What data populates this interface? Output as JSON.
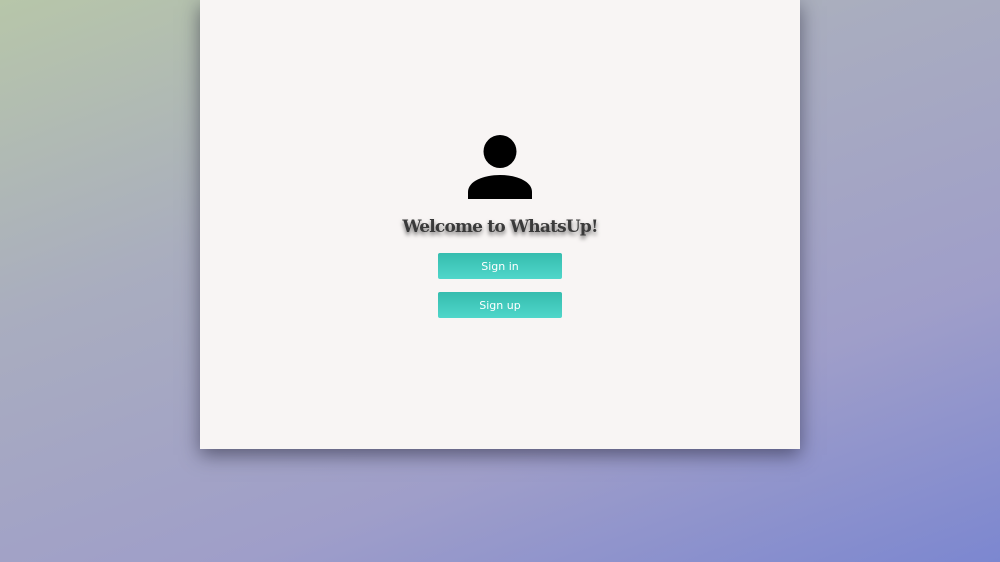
{
  "page": {
    "background_gradient": [
      "#b7c6a9",
      "#a9adbf",
      "#9f9ec9",
      "#7c87d0"
    ]
  },
  "card": {
    "background": "#f8f5f4",
    "avatar_icon": "user-icon",
    "title": "Welcome to WhatsUp!",
    "buttons": {
      "signin_label": "Sign in",
      "signup_label": "Sign up",
      "color": "#3ec6b8"
    }
  }
}
